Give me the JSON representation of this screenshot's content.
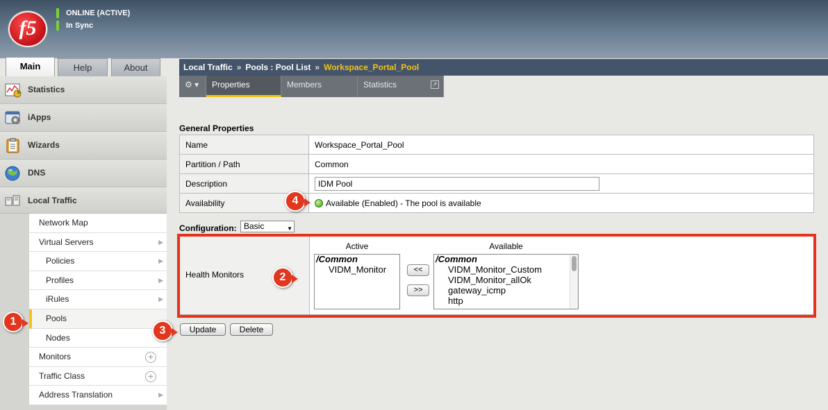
{
  "header": {
    "logo_text": "f5",
    "status_line1": "ONLINE (ACTIVE)",
    "status_line2": "In Sync",
    "status_color": "#7cd13a"
  },
  "top_tabs": {
    "main": "Main",
    "help": "Help",
    "about": "About"
  },
  "sidebar": {
    "items": [
      {
        "label": "Statistics",
        "icon": "statistics-chart-icon"
      },
      {
        "label": "iApps",
        "icon": "iapps-gear-icon"
      },
      {
        "label": "Wizards",
        "icon": "wizards-clipboard-icon"
      },
      {
        "label": "DNS",
        "icon": "dns-globe-icon"
      },
      {
        "label": "Local Traffic",
        "icon": "local-traffic-icon"
      }
    ],
    "submenu": [
      {
        "label": "Network Map"
      },
      {
        "label": "Virtual Servers"
      },
      {
        "label": "Policies"
      },
      {
        "label": "Profiles"
      },
      {
        "label": "iRules"
      },
      {
        "label": "Pools"
      },
      {
        "label": "Nodes"
      },
      {
        "label": "Monitors"
      },
      {
        "label": "Traffic Class"
      },
      {
        "label": "Address Translation"
      }
    ]
  },
  "breadcrumb": {
    "part1": "Local Traffic",
    "sep": "»",
    "part2": "Pools : Pool List",
    "current": "Workspace_Portal_Pool",
    "highlight_color": "#f3c317"
  },
  "subtabs": {
    "properties": "Properties",
    "members": "Members",
    "statistics": "Statistics"
  },
  "general": {
    "title": "General Properties",
    "rows": [
      {
        "label": "Name",
        "value": "Workspace_Portal_Pool"
      },
      {
        "label": "Partition / Path",
        "value": "Common"
      },
      {
        "label": "Description",
        "value": "IDM Pool"
      },
      {
        "label": "Availability",
        "value": "Available (Enabled) - The pool is available"
      }
    ]
  },
  "configuration": {
    "label": "Configuration:",
    "selected": "Basic"
  },
  "health_monitors": {
    "label": "Health Monitors",
    "active_title": "Active",
    "available_title": "Available",
    "active_group": "/Common",
    "active_items": [
      "VIDM_Monitor"
    ],
    "available_group": "/Common",
    "available_items": [
      "VIDM_Monitor_Custom",
      "VIDM_Monitor_allOk",
      "gateway_icmp",
      "http"
    ],
    "move_left": "<<",
    "move_right": ">>"
  },
  "actions": {
    "update": "Update",
    "delete": "Delete"
  },
  "callouts": [
    "1",
    "2",
    "3",
    "4"
  ],
  "callout_color": "#e2361f"
}
